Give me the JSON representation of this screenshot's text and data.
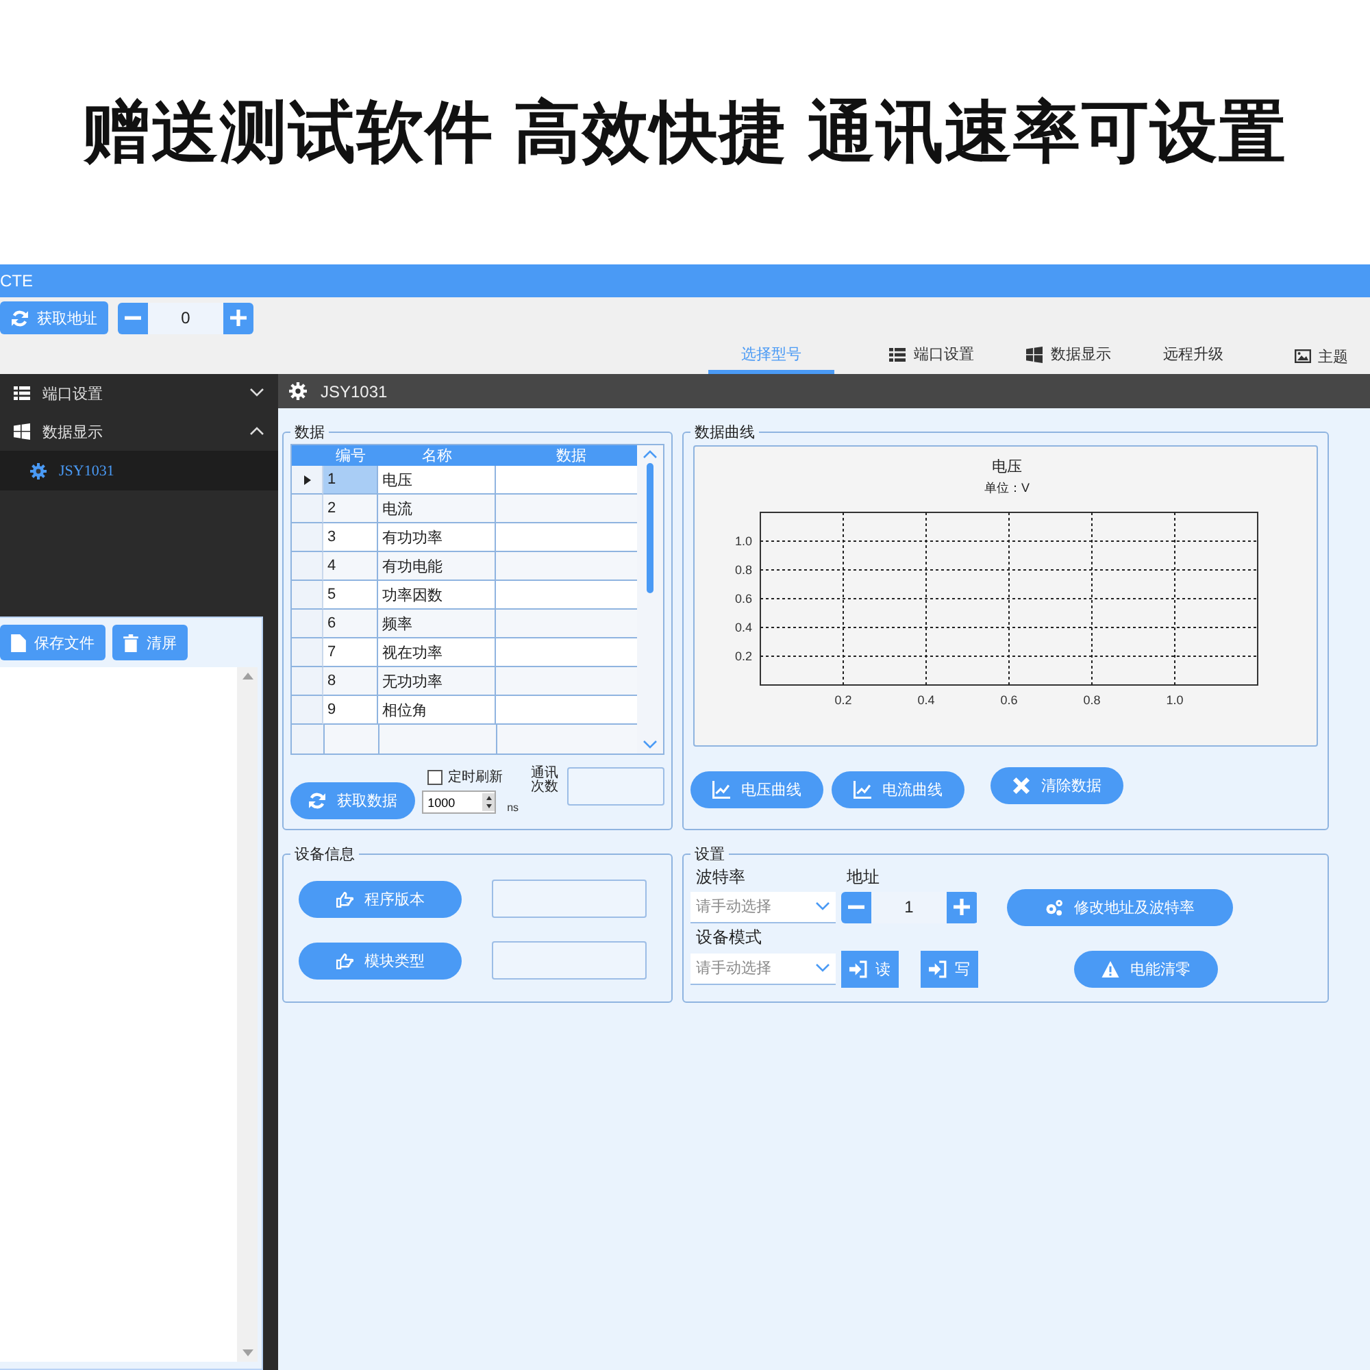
{
  "headline": "赠送测试软件 高效快捷 通讯速率可设置",
  "window": {
    "title": "CTE"
  },
  "toolbar": {
    "get_address_button": "获取地址",
    "address_value": "0"
  },
  "tabs": [
    {
      "label": "选择型号",
      "selected": true
    },
    {
      "label": "端口设置",
      "selected": false
    },
    {
      "label": "数据显示",
      "selected": false
    },
    {
      "label": "远程升级",
      "selected": false
    }
  ],
  "theme_menu": {
    "label": "主题"
  },
  "sidebar": {
    "items": [
      {
        "label": "端口设置",
        "expanded": false
      },
      {
        "label": "数据显示",
        "expanded": true,
        "children": [
          {
            "label": "JSY1031",
            "selected": true
          }
        ]
      }
    ]
  },
  "log_panel": {
    "buttons": [
      {
        "label": "保存文件"
      },
      {
        "label": "清屏"
      }
    ]
  },
  "content_header": {
    "title": "JSY1031"
  },
  "data_group": {
    "title": "数据",
    "table": {
      "columns": [
        "编号",
        "名称",
        "数据"
      ],
      "rows": [
        {
          "number": "1",
          "name": "电压",
          "selected": true
        },
        {
          "number": "2",
          "name": "电流",
          "selected": false
        },
        {
          "number": "3",
          "name": "有功功率",
          "selected": false
        },
        {
          "number": "4",
          "name": "有功电能",
          "selected": false
        },
        {
          "number": "5",
          "name": "功率因数",
          "selected": false
        },
        {
          "number": "6",
          "name": "频率",
          "selected": false
        },
        {
          "number": "7",
          "name": "视在功率",
          "selected": false
        },
        {
          "number": "8",
          "name": "无功功率",
          "selected": false
        },
        {
          "number": "9",
          "name": "相位角",
          "selected": false
        }
      ]
    },
    "get_data_button": "获取数据",
    "timer_refresh": {
      "label": "定时刷新",
      "checked": false
    },
    "interval": {
      "value": "1000",
      "unit": "ns"
    },
    "comm_count": {
      "label": "通讯次数"
    }
  },
  "chart_group": {
    "title": "数据曲线",
    "unit": "单位：V",
    "chart_data": {
      "type": "line",
      "title": "电压",
      "xlim": [
        0,
        1.2
      ],
      "ylim": [
        0,
        1.2
      ],
      "xticks": [
        0.2,
        0.4,
        0.6,
        0.8,
        {
          "value": 1,
          "label": "1.0"
        }
      ],
      "yticks": [
        0.2,
        0.4,
        0.6,
        0.8,
        {
          "value": 1,
          "label": "1.0"
        }
      ],
      "grid": true
    },
    "buttons": [
      {
        "label": "电压曲线"
      },
      {
        "label": "电流曲线"
      },
      {
        "label": "清除数据"
      }
    ]
  },
  "device_info": {
    "title": "设备信息",
    "buttons": [
      {
        "label": "程序版本"
      },
      {
        "label": "模块类型"
      }
    ]
  },
  "settings": {
    "title": "设置",
    "baud_rate": {
      "label": "波特率",
      "placeholder": "请手动选择"
    },
    "address": {
      "label": "地址",
      "value": "1"
    },
    "device_mode": {
      "label": "设备模式",
      "placeholder": "请手动选择"
    },
    "read_button": "读",
    "write_button": "写",
    "change_button": "修改地址及波特率",
    "clear_energy_button": "电能清零"
  }
}
